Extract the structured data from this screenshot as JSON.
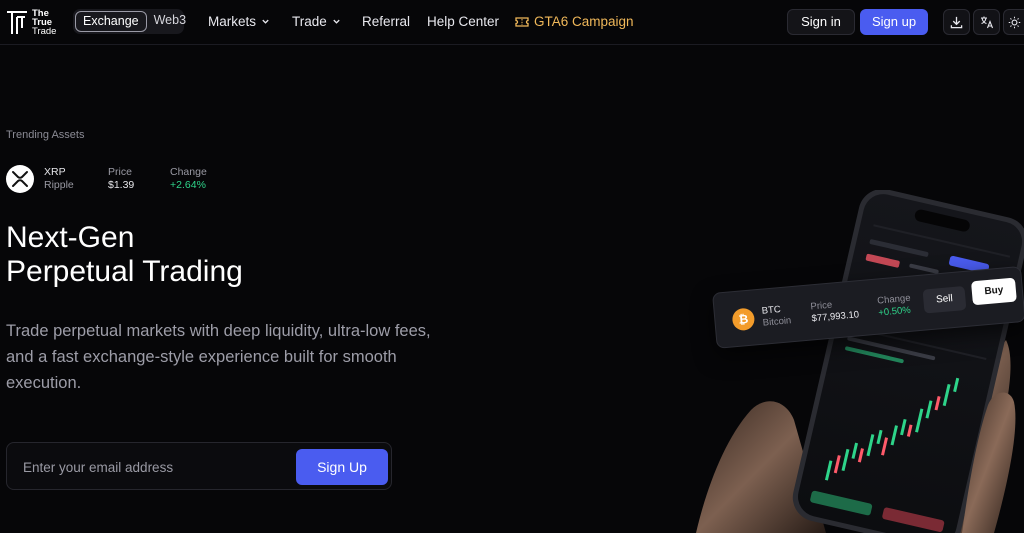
{
  "brand": {
    "line1": "The",
    "line2": "True",
    "line3": "Trade"
  },
  "mode_switch": {
    "items": [
      "Exchange",
      "Web3"
    ],
    "selected": "Exchange"
  },
  "nav": {
    "markets": "Markets",
    "trade": "Trade",
    "referral": "Referral",
    "help_center": "Help Center",
    "campaign": "GTA6 Campaign"
  },
  "auth": {
    "sign_in": "Sign in",
    "sign_up": "Sign up"
  },
  "toolbar_icons": [
    "download-icon",
    "translate-icon",
    "theme-sun-icon"
  ],
  "trending": {
    "label": "Trending Assets",
    "asset": {
      "symbol": "XRP",
      "name": "Ripple",
      "price_label": "Price",
      "price": "$1.39",
      "change_label": "Change",
      "change": "+2.64%"
    }
  },
  "hero": {
    "title_line1": "Next-Gen",
    "title_line2": "Perpetual Trading",
    "description": "Trade perpetual markets with deep liquidity, ultra-low fees, and a fast exchange-style experience built for smooth execution."
  },
  "signup_form": {
    "email_placeholder": "Enter your email address",
    "submit_label": "Sign Up"
  },
  "ticker_card": {
    "symbol": "BTC",
    "name": "Bitcoin",
    "coin_glyph": "₿",
    "price_label": "Price",
    "price": "$77,993.10",
    "change_label": "Change",
    "change": "+0.50%",
    "sell_label": "Sell",
    "buy_label": "Buy"
  },
  "colors": {
    "accent": "#4a5cf0",
    "positive": "#2ed48a",
    "campaign": "#f0b85a",
    "background": "#060608"
  }
}
